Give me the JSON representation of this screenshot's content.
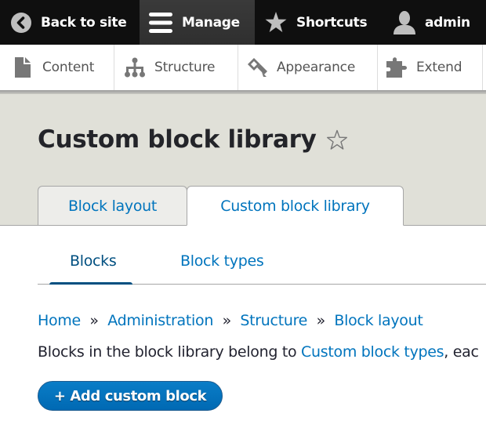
{
  "toolbar": {
    "back": {
      "label": "Back to site",
      "icon": "back-arrow-icon"
    },
    "manage": {
      "label": "Manage",
      "icon": "hamburger-menu-icon"
    },
    "shortcuts": {
      "label": "Shortcuts",
      "icon": "star-icon"
    },
    "user": {
      "label": "admin",
      "icon": "user-icon"
    }
  },
  "tray": {
    "items": [
      {
        "label": "Content",
        "icon": "file-icon"
      },
      {
        "label": "Structure",
        "icon": "sitemap-icon"
      },
      {
        "label": "Appearance",
        "icon": "paintbrush-icon"
      },
      {
        "label": "Extend",
        "icon": "puzzle-icon"
      }
    ]
  },
  "page": {
    "title": "Custom block library",
    "shortcut_icon": "star-outline-icon"
  },
  "primary_tabs": [
    {
      "label": "Block layout",
      "active": false
    },
    {
      "label": "Custom block library",
      "active": true
    }
  ],
  "secondary_tabs": [
    {
      "label": "Blocks",
      "active": true
    },
    {
      "label": "Block types",
      "active": false
    }
  ],
  "breadcrumb": {
    "items": [
      "Home",
      "Administration",
      "Structure",
      "Block layout"
    ],
    "separator": "»"
  },
  "description": {
    "prefix": "Blocks in the block library belong to ",
    "link": "Custom block types",
    "suffix": ", eac"
  },
  "actions": {
    "add_label": "+ Add custom block"
  },
  "colors": {
    "link": "#0074bd",
    "toolbar_bg": "#0f0f0f",
    "header_bg": "#e0e0d8",
    "button_bg": "#0074bd",
    "active_tab": "#004f80"
  }
}
